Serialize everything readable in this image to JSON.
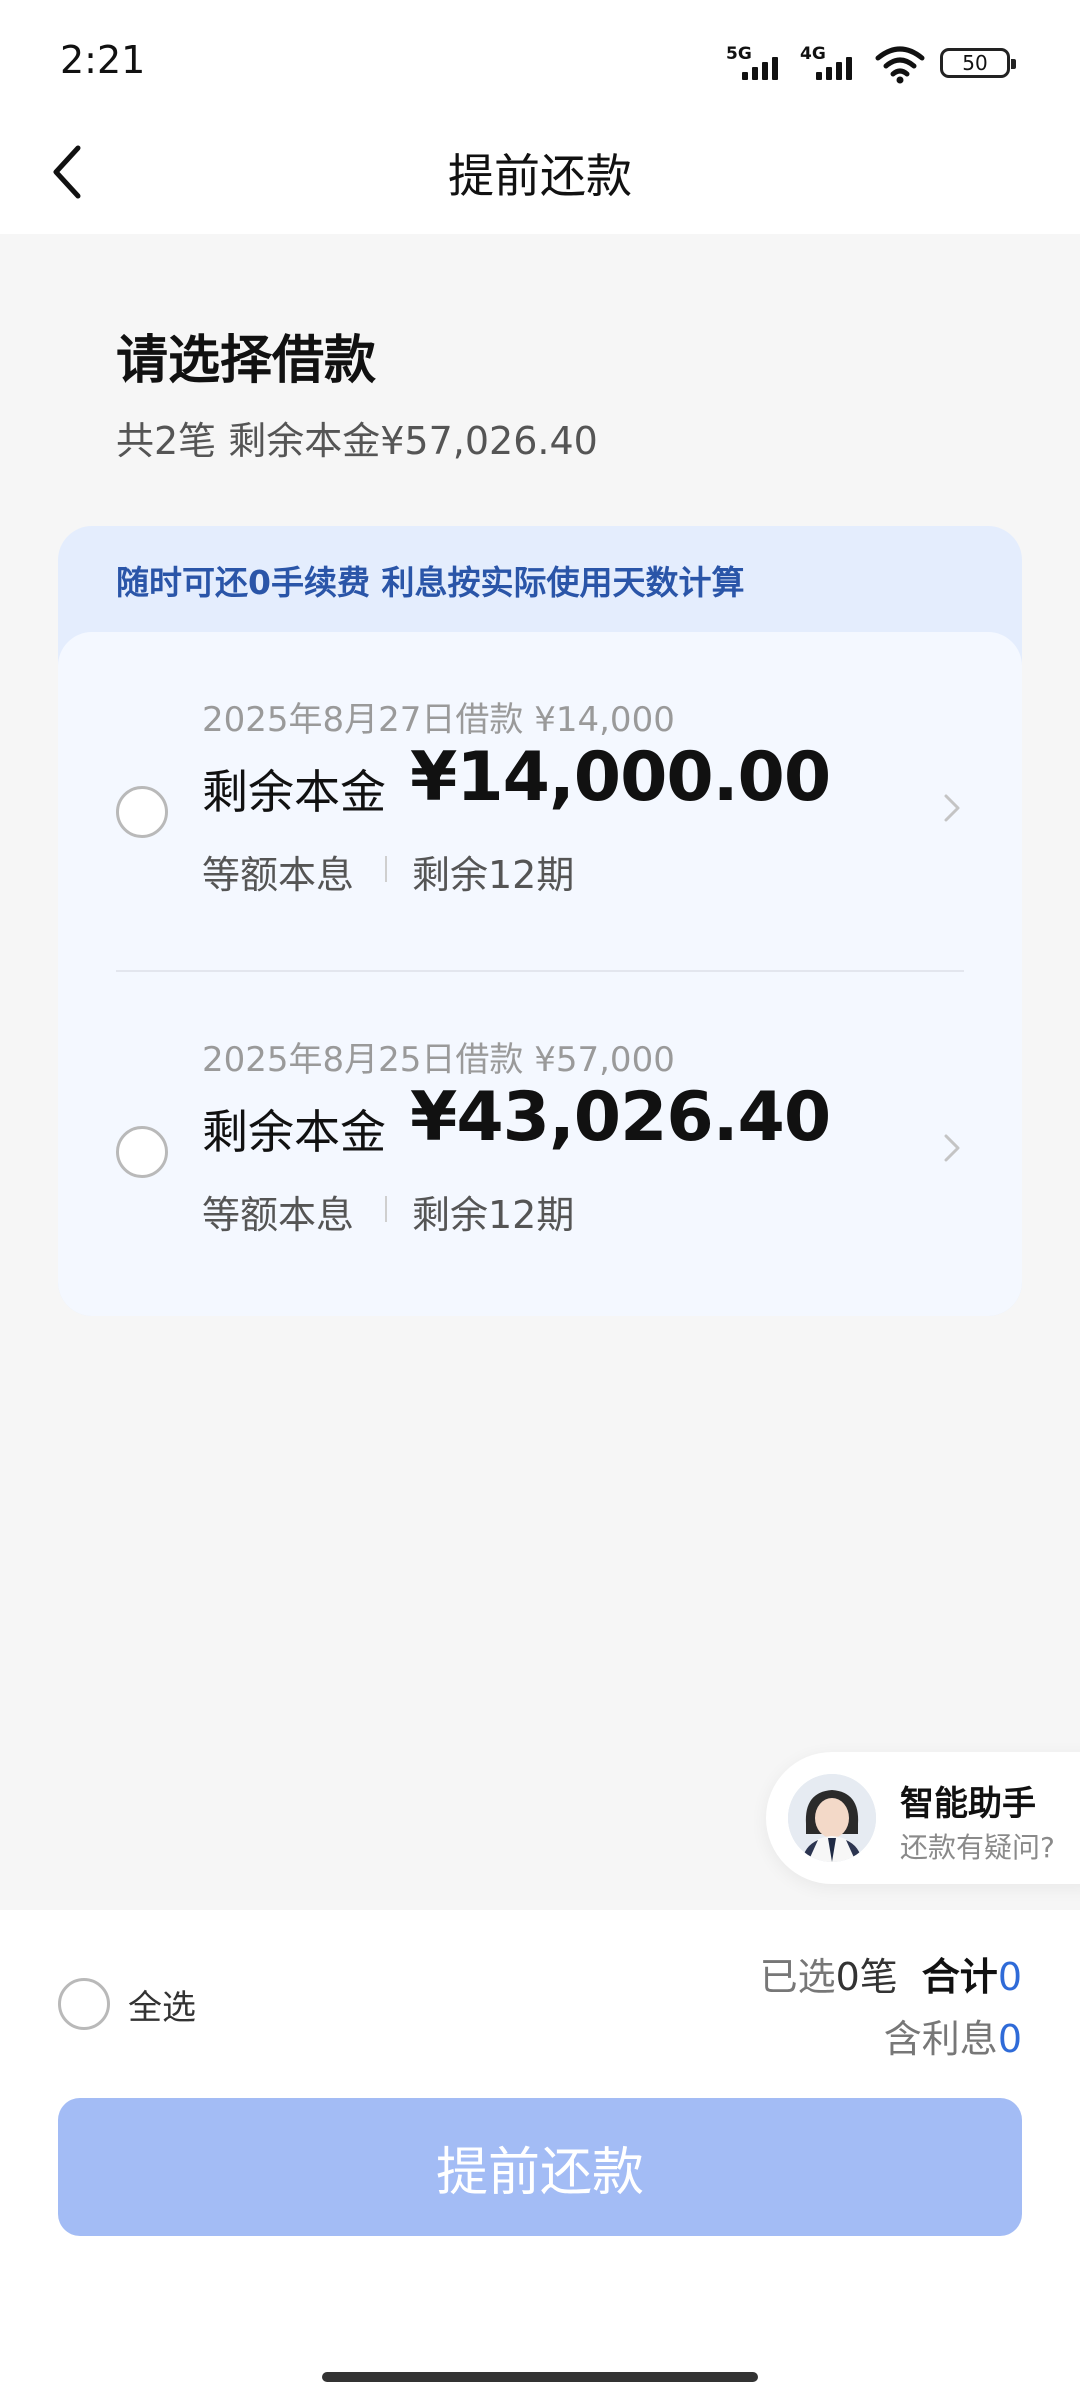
{
  "status_bar": {
    "time": "2:21",
    "network_1": "5G",
    "network_2": "4G",
    "battery": "50"
  },
  "navbar": {
    "title": "提前还款",
    "back_icon": "chevron-left-icon"
  },
  "heading": "请选择借款",
  "summary": "共2笔 剩余本金¥57,026.40",
  "banner": "随时可还0手续费 利息按实际使用天数计算",
  "loans": [
    {
      "date_line": "2025年8月27日借款 ¥14,000",
      "label": "剩余本金",
      "amount": "¥14,000.00",
      "type": "等额本息",
      "terms": "剩余12期"
    },
    {
      "date_line": "2025年8月25日借款 ¥57,000",
      "label": "剩余本金",
      "amount": "¥43,026.40",
      "type": "等额本息",
      "terms": "剩余12期"
    }
  ],
  "assistant": {
    "title": "智能助手",
    "subtitle": "还款有疑问?"
  },
  "bottom": {
    "select_all": "全选",
    "selected_prefix": "已选",
    "selected_count": "0",
    "selected_suffix": "笔",
    "total_label": "合计",
    "total_value": "0",
    "interest_label": "含利息",
    "interest_value": "0",
    "submit_label": "提前还款"
  },
  "colors": {
    "accent_blue": "#2f6bd8",
    "banner_text": "#2a55a8",
    "button_disabled": "#a3bcf5"
  }
}
